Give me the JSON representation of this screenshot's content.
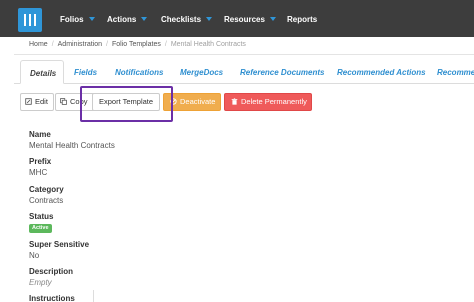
{
  "nav": {
    "items": [
      "Folios",
      "Actions",
      "Checklists",
      "Resources",
      "Reports"
    ]
  },
  "breadcrumb": {
    "items": [
      "Home",
      "Administration",
      "Folio Templates"
    ],
    "current": "Mental Health Contracts"
  },
  "tabs": [
    "Details",
    "Fields",
    "Notifications",
    "MergeDocs",
    "Reference Documents",
    "Recommended Actions",
    "Recomme"
  ],
  "toolbar": {
    "edit_label": "Edit",
    "copy_label": "Copy",
    "export_label": "Export Template",
    "deactivate_label": "Deactivate",
    "delete_label": "Delete Permanently"
  },
  "fields": {
    "name_label": "Name",
    "name_value": "Mental Health Contracts",
    "prefix_label": "Prefix",
    "prefix_value": "MHC",
    "category_label": "Category",
    "category_value": "Contracts",
    "status_label": "Status",
    "status_value": "Active",
    "super_sensitive_label": "Super Sensitive",
    "super_sensitive_value": "No",
    "description_label": "Description",
    "description_value": "Empty",
    "instructions_label": "Instructions"
  },
  "colors": {
    "topbar": "#3d3d3d",
    "brand": "#2f96d8",
    "tab_link": "#2f8fd0",
    "warning": "#f0ad4e",
    "danger": "#ef5a5a",
    "success": "#5cb85c",
    "highlight": "#6b2fa6"
  },
  "icons": {
    "logo": "app-logo",
    "edit": "edit-icon",
    "copy": "copy-icon",
    "deactivate": "ban-icon",
    "delete": "trash-icon",
    "dropdown": "caret-down-icon"
  }
}
